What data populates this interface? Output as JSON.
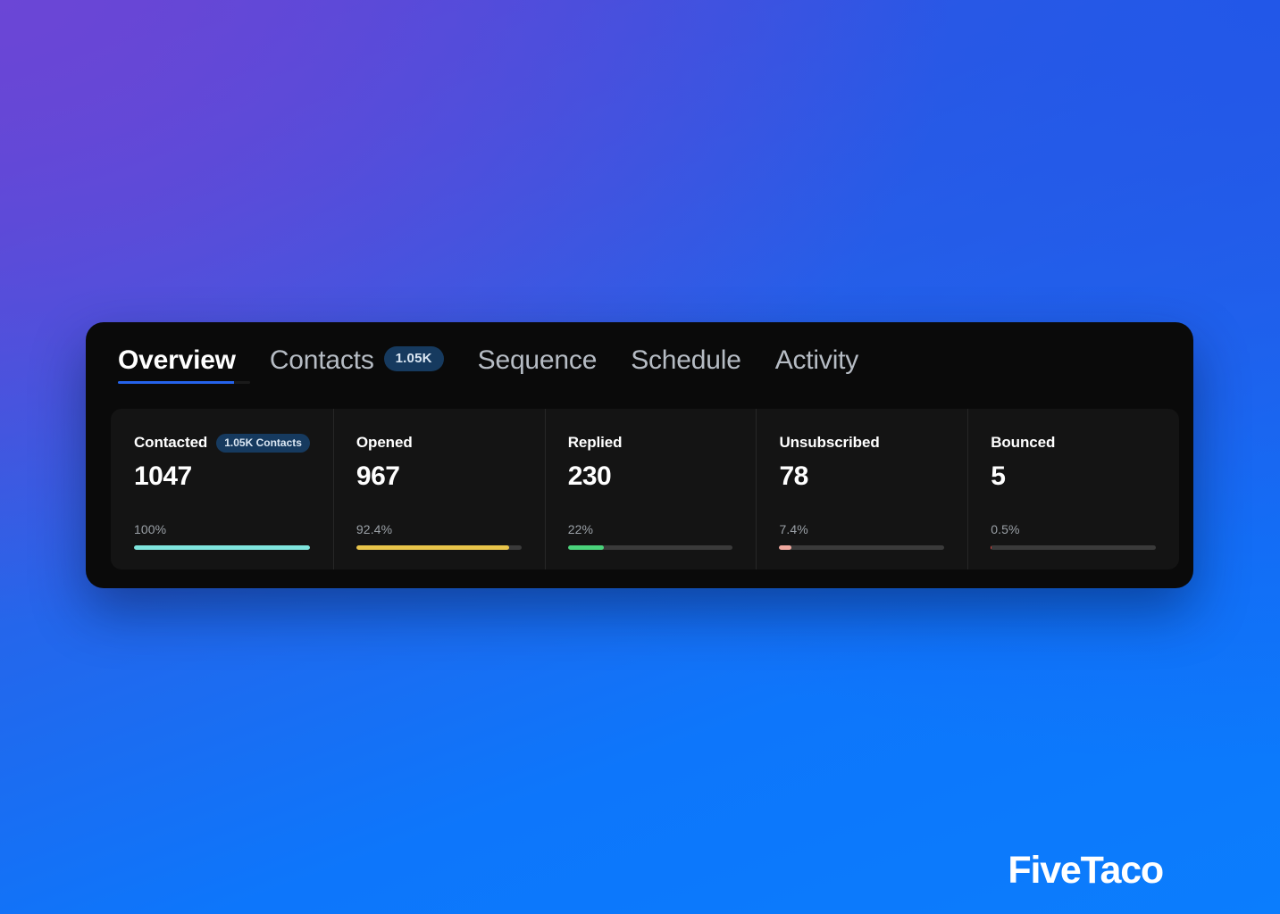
{
  "background": {
    "gradient_from": "#6b46d6",
    "gradient_mid": "#2f5fe4",
    "gradient_to": "#0b7dfd"
  },
  "panel": {
    "background": "#0a0a0a",
    "cards_background": "#141414"
  },
  "tabs": [
    {
      "label": "Overview",
      "active": true,
      "badge": null
    },
    {
      "label": "Contacts",
      "active": false,
      "badge": "1.05K"
    },
    {
      "label": "Sequence",
      "active": false,
      "badge": null
    },
    {
      "label": "Schedule",
      "active": false,
      "badge": null
    },
    {
      "label": "Activity",
      "active": false,
      "badge": null
    }
  ],
  "active_tab_indicator_color": "#2563eb",
  "stats": [
    {
      "label": "Contacted",
      "badge": "1.05K Contacts",
      "value": "1047",
      "percent_label": "100%",
      "percent": 100,
      "bar_color": "#7fe5dd"
    },
    {
      "label": "Opened",
      "badge": null,
      "value": "967",
      "percent_label": "92.4%",
      "percent": 92.4,
      "bar_color": "#e8c44a"
    },
    {
      "label": "Replied",
      "badge": null,
      "value": "230",
      "percent_label": "22%",
      "percent": 22,
      "bar_color": "#4ad37b"
    },
    {
      "label": "Unsubscribed",
      "badge": null,
      "value": "78",
      "percent_label": "7.4%",
      "percent": 7.4,
      "bar_color": "#efa89e"
    },
    {
      "label": "Bounced",
      "badge": null,
      "value": "5",
      "percent_label": "0.5%",
      "percent": 0.5,
      "bar_color": "#e0403c"
    }
  ],
  "brand": {
    "name": "FiveTaco"
  }
}
